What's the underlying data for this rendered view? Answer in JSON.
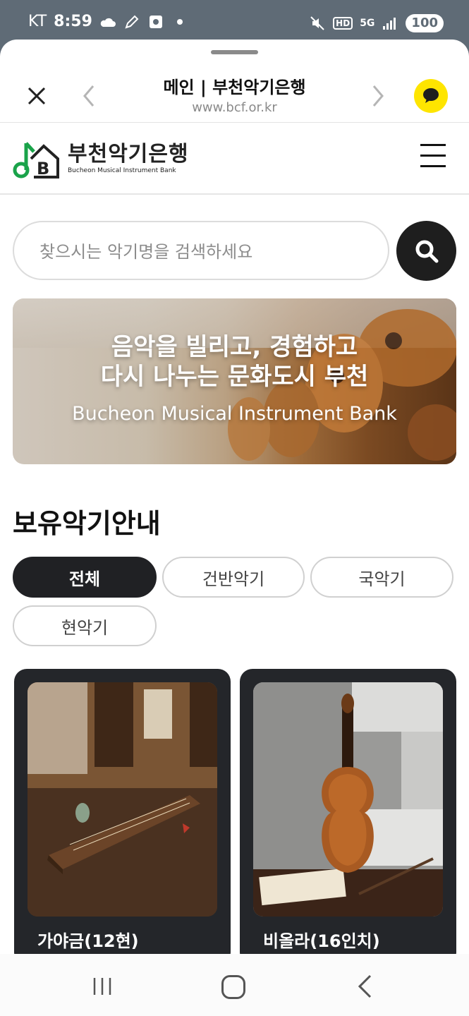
{
  "statusbar": {
    "carrier": "KT",
    "time": "8:59",
    "battery": "100",
    "hd_label": "HD",
    "network": "5G"
  },
  "browser": {
    "page_title": "메인 | 부천악기은행",
    "url": "www.bcf.or.kr"
  },
  "site": {
    "logo_ko": "부천악기은행",
    "logo_en": "Bucheon Musical Instrument Bank"
  },
  "search": {
    "placeholder": "찾으시는 악기명을 검색하세요"
  },
  "banner": {
    "line1": "음악을 빌리고, 경험하고",
    "line2": "다시 나누는 문화도시 부천",
    "subtitle": "Bucheon Musical Instrument Bank"
  },
  "section": {
    "title": "보유악기안내"
  },
  "filters": [
    {
      "label": "전체",
      "active": true
    },
    {
      "label": "건반악기",
      "active": false
    },
    {
      "label": "국악기",
      "active": false
    },
    {
      "label": "현악기",
      "active": false
    }
  ],
  "cards": [
    {
      "name": "가야금(12현)"
    },
    {
      "name": "비올라(16인치)"
    }
  ],
  "colors": {
    "status_bg": "#5f6b76",
    "accent_dark": "#202124",
    "kakao_yellow": "#fee500",
    "logo_green": "#1aa34a"
  }
}
